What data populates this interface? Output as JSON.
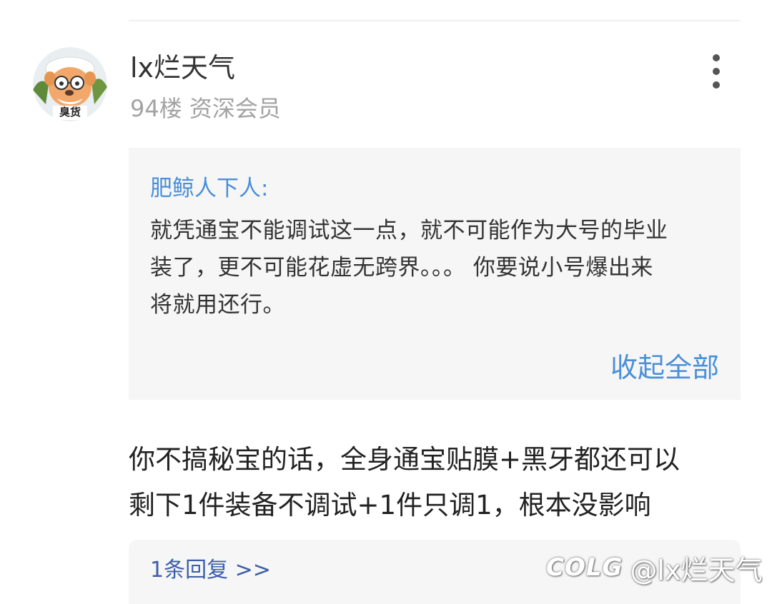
{
  "post": {
    "username": "lx烂天气",
    "meta": "94楼 资深会员",
    "avatar_badge": "臭货",
    "quote": {
      "author": "肥鲸人下人:",
      "lines": [
        "就凭通宝不能调试这一点，就不可能作为大号的毕业",
        "装了，更不可能花虚无跨界。。。 你要说小号爆出来",
        "将就用还行。"
      ],
      "collapse_label": "收起全部"
    },
    "body_lines": [
      "你不搞秘宝的话，全身通宝贴膜+黑牙都还可以",
      "剩下1件装备不调试+1件只调1，根本没影响"
    ],
    "replies_label": "1条回复 >>"
  },
  "watermark": {
    "logo": "COLG",
    "handle": "@lx烂天气"
  },
  "colors": {
    "link_blue": "#4a8fd8",
    "reply_blue": "#3d5ea8",
    "quote_bg": "#f6f6f6",
    "meta_gray": "#a3a3a3"
  },
  "icons": {
    "more_menu": "more-vertical-icon"
  }
}
